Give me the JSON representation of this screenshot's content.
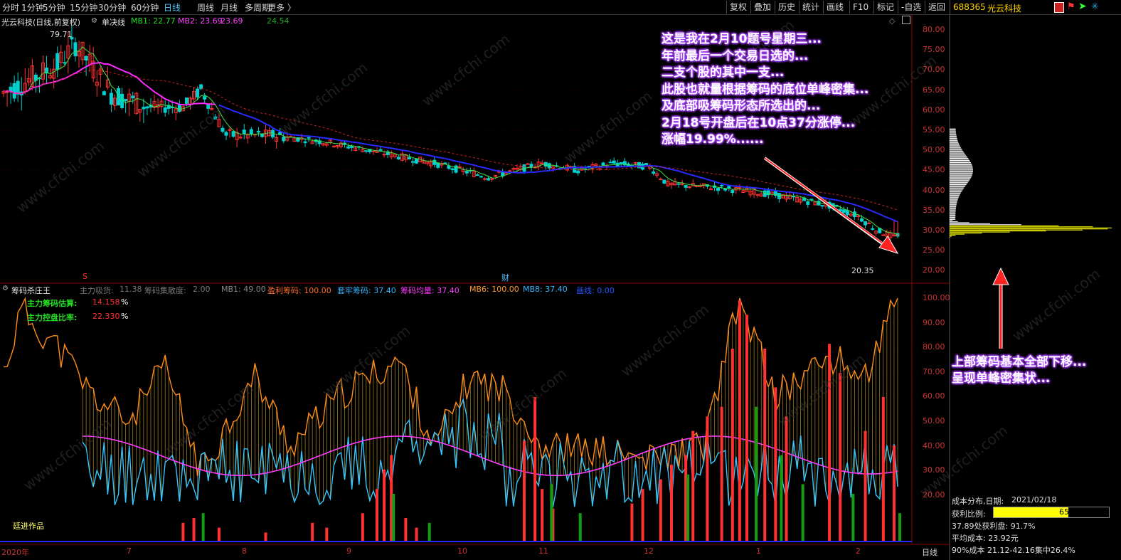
{
  "toolbar": {
    "periods": [
      "分时",
      "1分钟",
      "5分钟",
      "15分钟",
      "30分钟",
      "60分钟",
      "日线",
      "周线",
      "月线",
      "多周期",
      "更多 〉"
    ],
    "active_period": "日线",
    "tools": [
      "复权",
      "叠加",
      "历史",
      "统计",
      "画线",
      "F10",
      "标记",
      "-自选",
      "返回"
    ]
  },
  "stock": {
    "code": "688365",
    "name": "光云科技"
  },
  "main_chart": {
    "title": "光云科技(日线,前复权)",
    "indicator": "单决线",
    "mb1_label": "MB1: 22.77",
    "mb2_label": "MB2: 23.69",
    "mb2_value2": "23.69",
    "extra_value": "24.54",
    "high_label": "79.71",
    "low_label": "20.35",
    "y_ticks": [
      "80.00",
      "75.00",
      "70.00",
      "65.00",
      "60.00",
      "55.00",
      "50.00",
      "45.00",
      "40.00",
      "35.00",
      "30.00",
      "25.00",
      "20.00"
    ],
    "markers": [
      "S",
      "财"
    ]
  },
  "annotation_top": [
    "这是我在2月10题号星期三...",
    "年前最后一个交易日选的...",
    "二支个股的其中一支...",
    "此股也就量根据筹码的底位单峰密集...",
    "及底部吸筹码形态所选出的...",
    "2月18号开盘后在10点37分涨停...",
    "涨幅19.99%......"
  ],
  "annotation_right": [
    "上部筹码基本全部下移...",
    "呈现单峰密集状..."
  ],
  "sub_chart": {
    "title": "筹码杀庄王",
    "legend": [
      {
        "text": "主力吸货:",
        "color": "#777777"
      },
      {
        "text": "11.38",
        "color": "#777777"
      },
      {
        "text": "筹码集散度:",
        "color": "#777777"
      },
      {
        "text": "2.00",
        "color": "#777777"
      },
      {
        "text": "MB1: 49.00",
        "color": "#888888"
      },
      {
        "text": "盈利筹码: 100.00",
        "color": "#ff6a2a"
      },
      {
        "text": "套牢筹码: 37.40",
        "color": "#35b5ff"
      },
      {
        "text": "筹码均量: 37.40",
        "color": "#ff3cff"
      },
      {
        "text": "MB6: 100.00",
        "color": "#ff9933"
      },
      {
        "text": "MB8: 37.40",
        "color": "#35b5ff"
      },
      {
        "text": "画线: 0.00",
        "color": "#2255ff"
      }
    ],
    "main_force_label": "主力筹码估算:",
    "main_force_value": "14.158",
    "control_label": "主力控盘比率:",
    "control_value": "22.330",
    "pct": "%",
    "author": "廷进作品",
    "y_ticks": [
      "100.00",
      "90.00",
      "80.00",
      "70.00",
      "60.00",
      "50.00",
      "40.00",
      "30.00",
      "20.00"
    ]
  },
  "x_axis": {
    "labels": [
      "2020年",
      "7",
      "8",
      "9",
      "10",
      "11",
      "12",
      "1",
      "2"
    ],
    "period": "日线"
  },
  "chip_dist": {
    "title": "成本分布,日期:",
    "date": "2021/02/18",
    "profit_ratio_label": "获利比例:",
    "profit_ratio": "65.1%",
    "profit_ratio_value": 0.651,
    "line1": "37.89处获利盘:  91.7%",
    "line2": "平均成本:  23.92元",
    "line3": "90%成本  21.12-42.16集中26.4%"
  },
  "watermark": "www.cfchi.com",
  "colors": {
    "up": "#ff3232",
    "down": "#00d0d0",
    "ma_blue": "#2a2aff",
    "ma_magenta": "#ff2aff",
    "chip": "#ffff00",
    "accent": "#4fc3ff"
  }
}
